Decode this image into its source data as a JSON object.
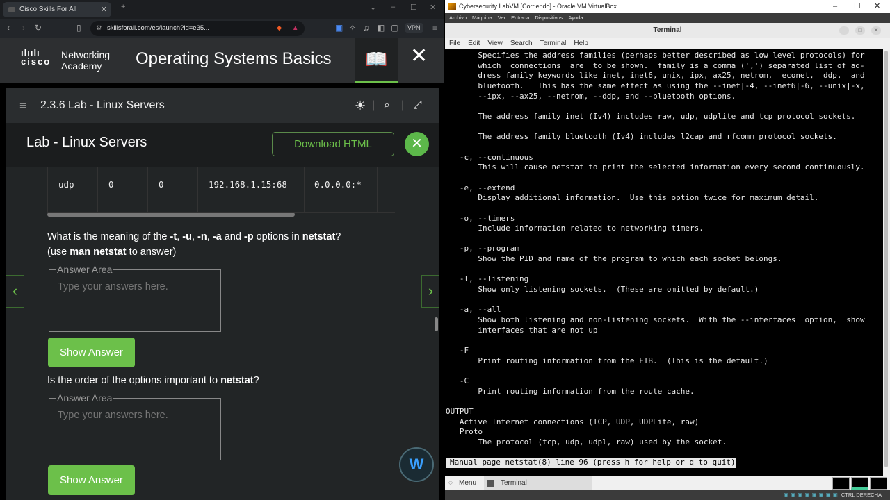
{
  "browser": {
    "tab_title": "Cisco Skills For All",
    "url": "skillsforall.com/es/launch?id=e35...",
    "vpn_label": "VPN"
  },
  "cisco_header": {
    "logo_text": "cisco",
    "logo_line1": "Networking",
    "logo_line2": "Academy",
    "course_title": "Operating Systems Basics"
  },
  "panel": {
    "breadcrumb": "2.3.6 Lab - Linux Servers",
    "title": "Lab - Linux Servers",
    "download_label": "Download HTML",
    "table_row": [
      "udp",
      "0",
      "0",
      "192.168.1.15:68",
      "0.0.0.0:*"
    ],
    "q1": {
      "p1": "What is the meaning of the ",
      "o1": "-t",
      ",1": ", ",
      "o2": "-u",
      ",2": ", ",
      "o3": "-n",
      ",3": ", ",
      "o4": "-a",
      "and": " and ",
      "o5": "-p",
      "p2": " options in ",
      "cmd": "netstat",
      "p3": "?",
      "p4": "(use ",
      "man": "man netstat",
      "p5": " to answer)"
    },
    "q2": {
      "p1": "Is the order of the options important to ",
      "cmd": "netstat",
      "p2": "?"
    },
    "answer_legend": "Answer Area",
    "answer_placeholder": "Type your answers here.",
    "show_answer_label": "Show Answer"
  },
  "vm": {
    "window_title": "Cybersecurity LabVM [Corriendo] - Oracle VM VirtualBox",
    "menu": [
      "Archivo",
      "Máquina",
      "Ver",
      "Entrada",
      "Dispositivos",
      "Ayuda"
    ],
    "terminal_title": "Terminal",
    "terminal_menu": [
      "File",
      "Edit",
      "View",
      "Search",
      "Terminal",
      "Help"
    ],
    "line1_pre": "       which  connections  are  to be shown.  ",
    "line1_u": "family",
    "line1_post": " is a comma (',') separated list of ad-",
    "lines": [
      "       Specifies the address families (perhaps better described as low level protocols) for",
      "",
      "       dress family keywords like inet, inet6, unix, ipx, ax25, netrom,  econet,  ddp,  and",
      "       bluetooth.   This has the same effect as using the --inet|-4, --inet6|-6, --unix|-x,",
      "       --ipx, --ax25, --netrom, --ddp, and --bluetooth options.",
      "",
      "       The address family inet (Iv4) includes raw, udp, udplite and tcp protocol sockets.",
      "",
      "       The address family bluetooth (Iv4) includes l2cap and rfcomm protocol sockets.",
      "",
      "   -c, --continuous",
      "       This will cause netstat to print the selected information every second continuously.",
      "",
      "   -e, --extend",
      "       Display additional information.  Use this option twice for maximum detail.",
      "",
      "   -o, --timers",
      "       Include information related to networking timers.",
      "",
      "   -p, --program",
      "       Show the PID and name of the program to which each socket belongs.",
      "",
      "   -l, --listening",
      "       Show only listening sockets.  (These are omitted by default.)",
      "",
      "   -a, --all",
      "       Show both listening and non-listening sockets.  With the --interfaces  option,  show",
      "       interfaces that are not up",
      "",
      "   -F",
      "       Print routing information from the FIB.  (This is the default.)",
      "",
      "   -C",
      "       Print routing information from the route cache.",
      "",
      "OUTPUT",
      "   Active Internet connections (TCP, UDP, UDPLite, raw)",
      "   Proto",
      "       The protocol (tcp, udp, udpl, raw) used by the socket.",
      ""
    ],
    "status_line": "Manual page netstat(8) line 96 (press h for help or q to quit)",
    "taskbar_menu": "Menu",
    "taskbar_terminal": "Terminal",
    "host_key": "CTRL DERECHA"
  },
  "colors": {
    "accent_green": "#6cc04a",
    "terminal_bg": "#000000"
  }
}
